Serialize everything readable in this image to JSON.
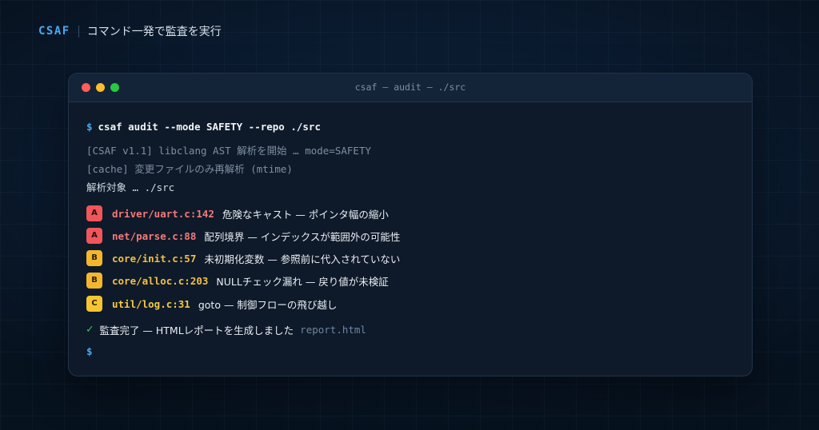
{
  "header": {
    "brand": "CSAF",
    "tagline": "コマンド一発で監査を実行"
  },
  "terminal": {
    "title": "csaf — audit — ./src",
    "prompt_symbol": "$",
    "command": "csaf audit --mode SAFETY --repo ./src",
    "log_lines": [
      "[CSAF v1.1] libclang AST 解析を開始 … mode=SAFETY",
      "[cache] 変更ファイルのみ再解析 (mtime)"
    ],
    "target_line": "解析対象 … ./src",
    "findings": [
      {
        "severity": "A",
        "location": "driver/uart.c:142",
        "message": "危険なキャスト — ポインタ幅の縮小"
      },
      {
        "severity": "A",
        "location": "net/parse.c:88",
        "message": "配列境界 — インデックスが範囲外の可能性"
      },
      {
        "severity": "B",
        "location": "core/init.c:57",
        "message": "未初期化変数 — 参照前に代入されていない"
      },
      {
        "severity": "B",
        "location": "core/alloc.c:203",
        "message": "NULLチェック漏れ — 戻り値が未検証"
      },
      {
        "severity": "C",
        "location": "util/log.c:31",
        "message": "goto — 制御フローの飛び越し"
      }
    ],
    "completion_symbol": "✓",
    "completion_message": "監査完了 — HTMLレポートを生成しました",
    "report_file": "report.html"
  },
  "colors": {
    "accent": "#4aa8f0",
    "severity_a": "#f0565a",
    "severity_b": "#f3b72e",
    "severity_c": "#f7c52f",
    "success": "#3ccf66"
  }
}
